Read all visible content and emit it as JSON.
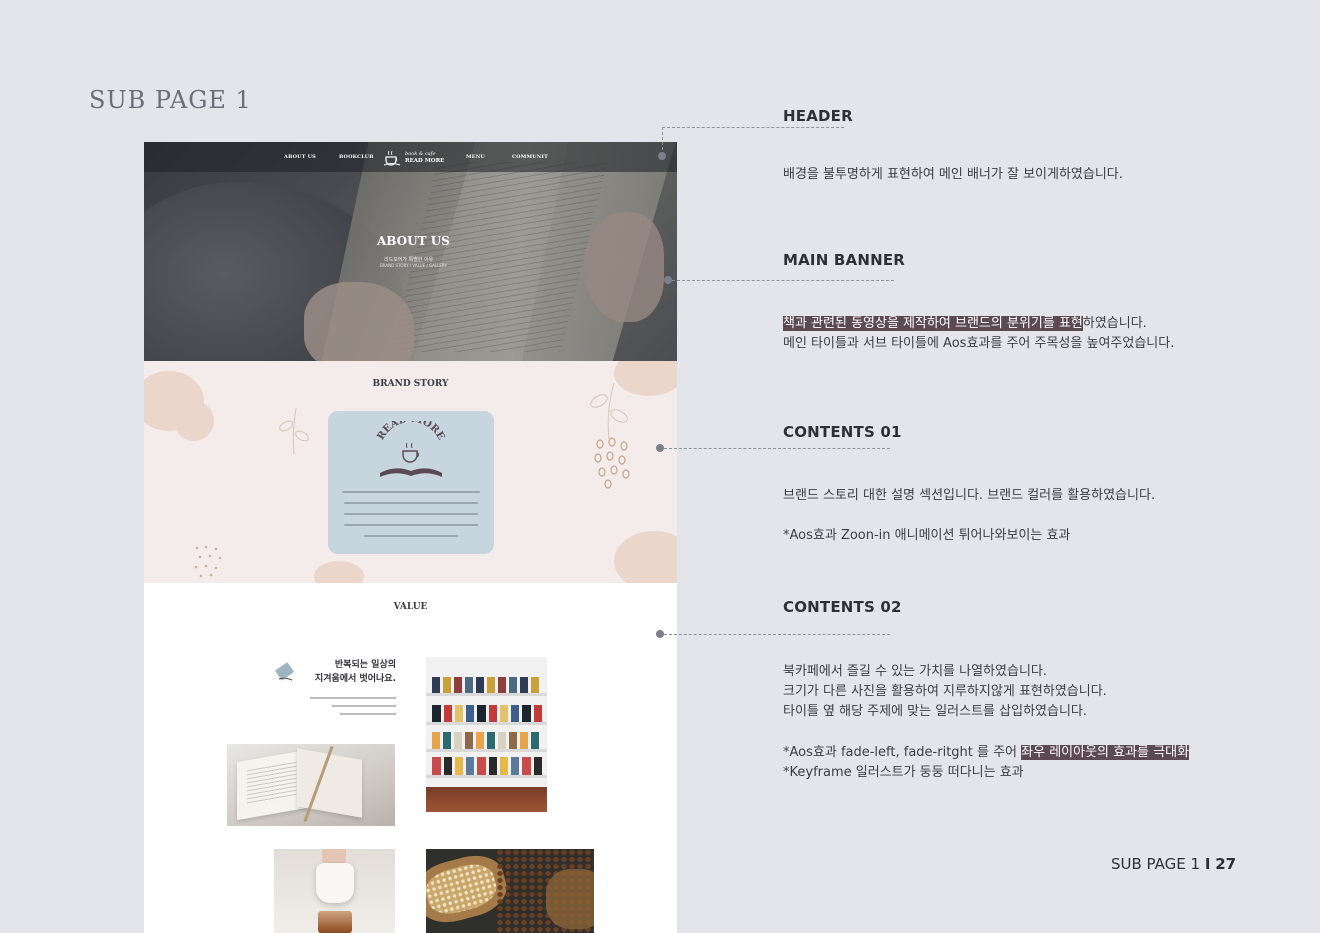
{
  "page_title": "SUB PAGE 1",
  "mockup": {
    "nav": {
      "items": [
        "ABOUT US",
        "BOOKCLUB",
        "MENU",
        "COMMUNIT"
      ],
      "logo_small": "book & cafe",
      "logo_big": "READ MORE"
    },
    "banner": {
      "title": "ABOUT US",
      "subtitle": "리드모어가 특별한 이유",
      "submenu": "BRAND STORY / VALUE / GALLERY"
    },
    "brand_story": {
      "title": "BRAND STORY",
      "card_logo": "READ MORE"
    },
    "value": {
      "title": "VALUE",
      "heading_line1": "반복되는 일상의",
      "heading_line2": "지겨움에서 벗어나요."
    }
  },
  "annotations": [
    {
      "title": "HEADER",
      "lines": [
        "배경을 불투명하게 표현하여 메인 배너가 잘 보이게하였습니다."
      ]
    },
    {
      "title": "MAIN BANNER",
      "lines": [
        {
          "highlight": "책과 관련된 동영상을 제작하여 브랜드의 분위기를 표현",
          "rest": "하였습니다."
        },
        "메인 타이틀과 서브 타이틀에 Aos효과를 주어 주목성을 높여주었습니다."
      ]
    },
    {
      "title": "CONTENTS 01",
      "lines": [
        "브랜드 스토리 대한 설명 섹션입니다. 브랜드 컬러를 활용하였습니다.",
        "*Aos효과 Zoon-in 애니메이션 튀어나와보이는 효과"
      ]
    },
    {
      "title": "CONTENTS 02",
      "lines": [
        "북카페에서 즐길 수 있는 가치를 나열하였습니다.",
        "크기가 다른 사진을 활용하여 지루하지않게 표현하였습니다.",
        "타이틀 옆 해당 주제에 맞는 일러스트를 삽입하였습니다.",
        {
          "before": "*Aos효과 fade-left, fade-ritght 를 주어 ",
          "highlight": "좌우 레이아웃의 효과를 극대화"
        },
        "*Keyframe 일러스트가 둥둥 떠다니는 효과"
      ]
    }
  ],
  "footer": {
    "label": "SUB PAGE  1",
    "page": "27"
  },
  "colors": {
    "background": "#e4e5ea",
    "highlight": "#5b4a52",
    "brand_section": "#f3eceb",
    "brand_card": "#c6d5de",
    "accent_brown": "#5b4a52"
  }
}
